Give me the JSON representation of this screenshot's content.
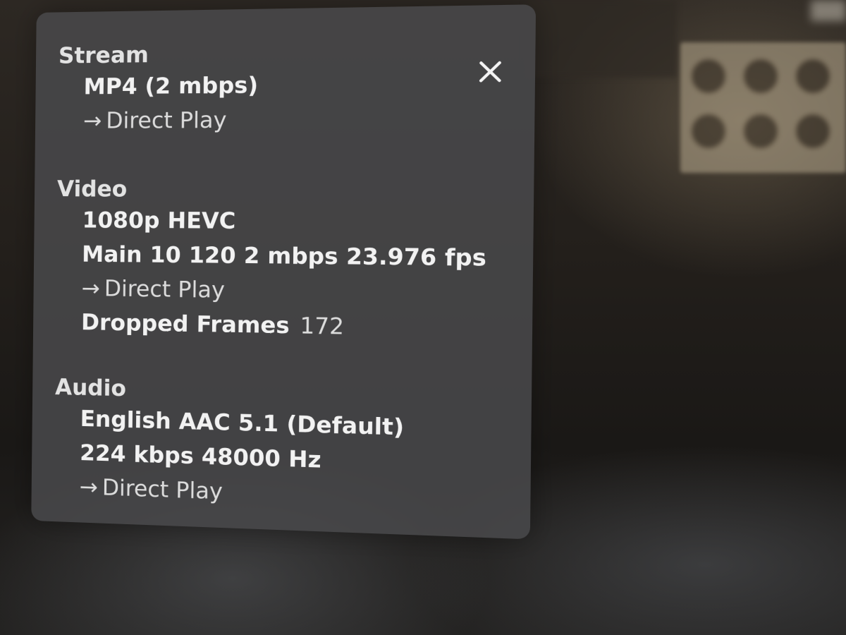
{
  "overlay": {
    "close_icon": "close-icon"
  },
  "stream": {
    "title": "Stream",
    "format": "MP4 (2 mbps)",
    "playback_arrow": "→",
    "playback": "Direct Play"
  },
  "video": {
    "title": "Video",
    "resolution_codec": "1080p HEVC",
    "details": "Main 10 120 2 mbps 23.976 fps",
    "playback_arrow": "→",
    "playback": "Direct Play",
    "dropped_frames_label": "Dropped Frames",
    "dropped_frames_value": "172"
  },
  "audio": {
    "title": "Audio",
    "track": "English AAC 5.1 (Default)",
    "details": "224 kbps 48000 Hz",
    "playback_arrow": "→",
    "playback": "Direct Play"
  }
}
